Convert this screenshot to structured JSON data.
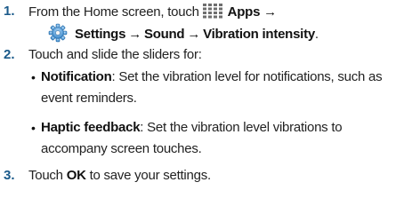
{
  "steps": [
    {
      "number": "1.",
      "line1": {
        "prefix": "From the Home screen, touch",
        "apps_label": "Apps",
        "arrow": "→"
      },
      "line2": {
        "settings_label": "Settings",
        "arrow1": "→",
        "sound_label": "Sound",
        "arrow2": "→",
        "vibration_label": "Vibration intensity",
        "end": "."
      },
      "icons": [
        "apps-grid-icon",
        "settings-gear-icon"
      ]
    },
    {
      "number": "2.",
      "text": "Touch and slide the sliders for:",
      "bullets": [
        {
          "title": "Notification",
          "desc_line1": ": Set the vibration level for notifications, such as",
          "desc_line2": "event reminders."
        },
        {
          "title": "Haptic feedback",
          "desc_line1": ": Set the vibration level vibrations to",
          "desc_line2": "accompany screen touches."
        }
      ]
    },
    {
      "number": "3.",
      "prefix": "Touch",
      "ok_label": "OK",
      "suffix": "to save your settings."
    }
  ],
  "colors": {
    "step_number": "#1a5a8a",
    "text": "#222222",
    "apps_icon": "#707070",
    "settings_icon": "#3a8fd0"
  }
}
